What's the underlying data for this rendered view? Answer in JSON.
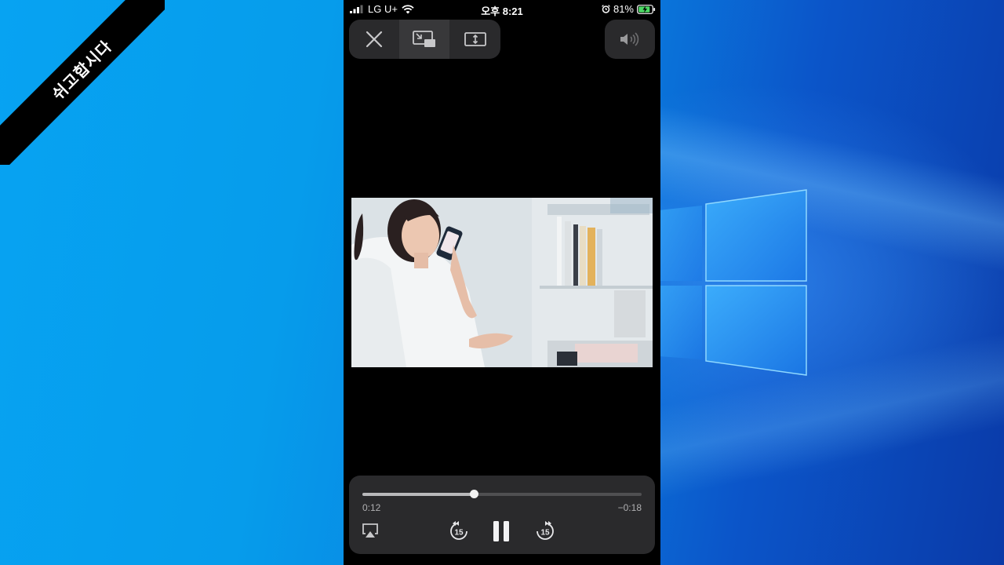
{
  "ribbon": {
    "text": "쉬고합시다"
  },
  "status_bar": {
    "carrier": "LG U+",
    "time": "오후 8:21",
    "battery_percent": "81%",
    "icons": [
      "signal-icon",
      "wifi-icon",
      "alarm-icon",
      "battery-charging-icon"
    ]
  },
  "top_controls": {
    "buttons": [
      "close-icon",
      "picture-in-picture-icon",
      "aspect-fit-icon"
    ],
    "volume_icon": "speaker-volume-icon"
  },
  "player": {
    "progress": 0.4,
    "elapsed": "0:12",
    "remaining": "−0:18",
    "skip_back_seconds": "15",
    "skip_forward_seconds": "15",
    "controls": [
      "airplay-icon",
      "skip-back-15-icon",
      "pause-icon",
      "skip-forward-15-icon"
    ]
  },
  "colors": {
    "panel": "#2a2a2c",
    "progress_fill": "#b9b9bb",
    "progress_track": "#505052",
    "battery_charge": "#4cd964"
  }
}
